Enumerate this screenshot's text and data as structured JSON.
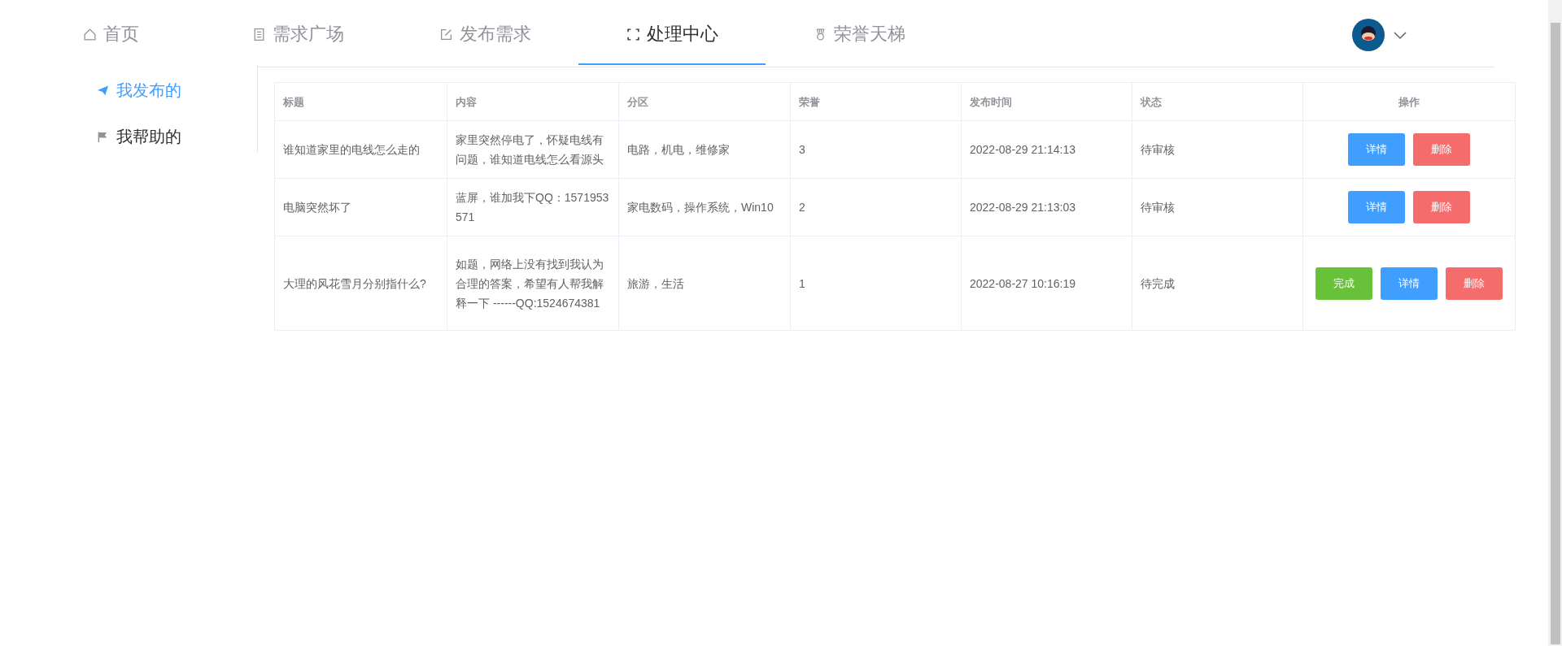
{
  "nav": {
    "tabs": [
      {
        "label": "首页",
        "kind": "home",
        "selected": false
      },
      {
        "label": "需求广场",
        "kind": "list",
        "selected": false
      },
      {
        "label": "发布需求",
        "kind": "publish",
        "selected": false
      },
      {
        "label": "处理中心",
        "kind": "center",
        "selected": true
      },
      {
        "label": "荣誉天梯",
        "kind": "ladder",
        "selected": false
      }
    ]
  },
  "sidebar": {
    "items": [
      {
        "label": "我发布的",
        "kind": "published",
        "selected": true
      },
      {
        "label": "我帮助的",
        "kind": "helped",
        "selected": false
      }
    ]
  },
  "table": {
    "columns": [
      "标题",
      "内容",
      "分区",
      "荣誉",
      "发布时间",
      "状态",
      "操作"
    ],
    "rows": [
      {
        "title": "谁知道家里的电线怎么走的",
        "content": "家里突然停电了，怀疑电线有问题，谁知道电线怎么看源头",
        "section": "电路，机电，维修家",
        "honor": "3",
        "time": "2022-08-29 21:14:13",
        "status": "待审核",
        "actions": [
          {
            "label": "详情",
            "kind": "detail"
          },
          {
            "label": "删除",
            "kind": "delete"
          }
        ]
      },
      {
        "title": "电脑突然坏了",
        "content": "蓝屏，谁加我下QQ：1571953571",
        "section": "家电数码，操作系统，Win10",
        "honor": "2",
        "time": "2022-08-29 21:13:03",
        "status": "待审核",
        "actions": [
          {
            "label": "详情",
            "kind": "detail"
          },
          {
            "label": "删除",
            "kind": "delete"
          }
        ]
      },
      {
        "title": "大理的风花雪月分别指什么?",
        "content": "如题，网络上没有找到我认为合理的答案，希望有人帮我解释一下 ------QQ:1524674381",
        "section": "旅游，生活",
        "honor": "1",
        "time": "2022-08-27 10:16:19",
        "status": "待完成",
        "actions": [
          {
            "label": "完成",
            "kind": "complete"
          },
          {
            "label": "详情",
            "kind": "detail"
          },
          {
            "label": "删除",
            "kind": "delete"
          }
        ]
      }
    ]
  }
}
